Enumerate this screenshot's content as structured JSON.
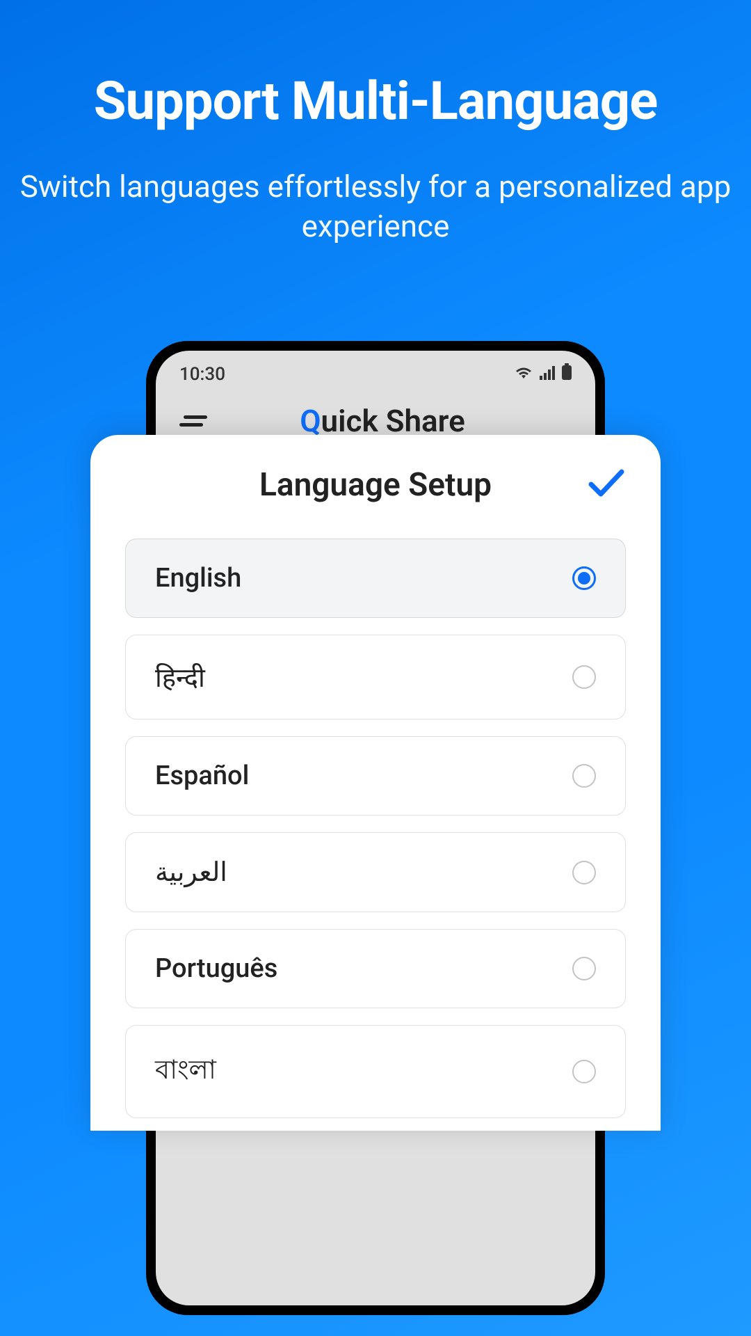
{
  "hero": {
    "title": "Support Multi-Language",
    "subtitle": "Switch languages effortlessly for a personalized app experience"
  },
  "statusBar": {
    "time": "10:30"
  },
  "appHeader": {
    "titlePrefix": "Q",
    "titleRest": "uick Share"
  },
  "sheet": {
    "title": "Language Setup"
  },
  "languages": [
    {
      "label": "English",
      "selected": true
    },
    {
      "label": "हिन्दी",
      "selected": false
    },
    {
      "label": "Español",
      "selected": false
    },
    {
      "label": "العربية",
      "selected": false
    },
    {
      "label": "Português",
      "selected": false
    },
    {
      "label": "বাংলা",
      "selected": false
    }
  ],
  "colors": {
    "accent": "#0d6efd",
    "bgGradientStart": "#0070e8",
    "bgGradientEnd": "#1f9aff"
  }
}
